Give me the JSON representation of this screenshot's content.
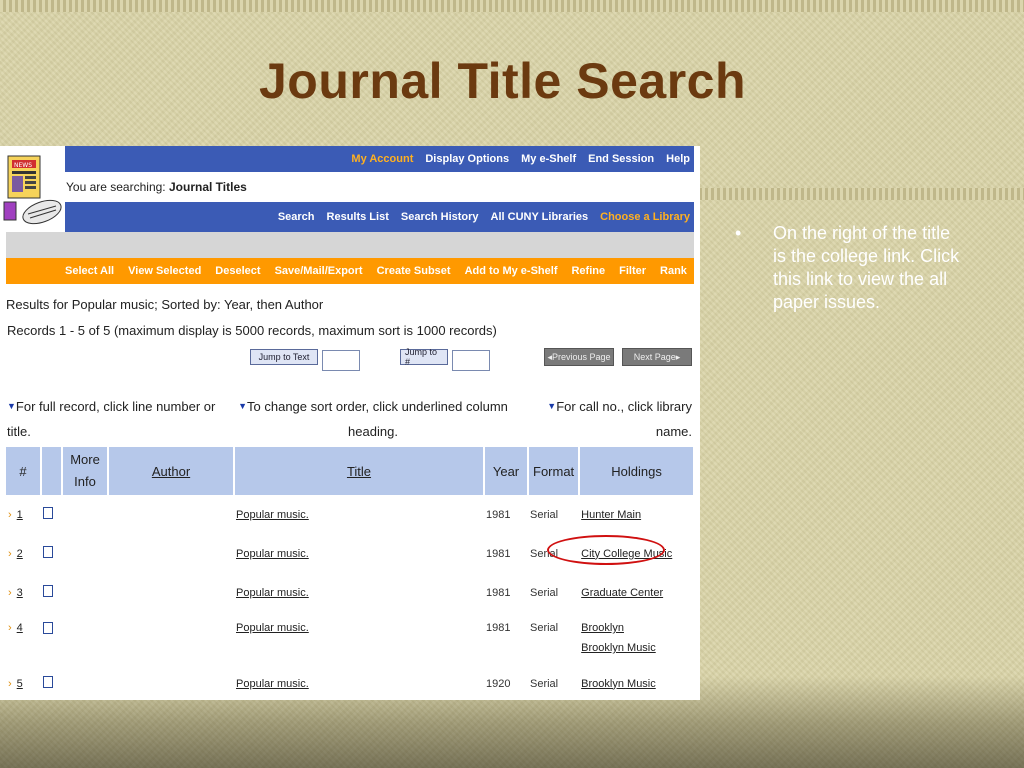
{
  "slide": {
    "title": "Journal Title Search",
    "bullet_char": "•",
    "bullet_text": "On the right of the title is the college link. Click this link to view the all paper issues."
  },
  "nav_top": {
    "items": [
      "My Account",
      "Display Options",
      "My e-Shelf",
      "End Session",
      "Help"
    ],
    "highlight": "My Account"
  },
  "searching": {
    "prefix": "You are searching:",
    "value": "Journal Titles"
  },
  "nav_second": {
    "items": [
      "Search",
      "Results List",
      "Search History",
      "All CUNY Libraries",
      "Choose a Library"
    ],
    "highlight": "Choose a Library"
  },
  "actions": [
    "Select All",
    "View Selected",
    "Deselect",
    "Save/Mail/Export",
    "Create Subset",
    "Add to My e-Shelf",
    "Refine",
    "Filter",
    "Rank"
  ],
  "results": {
    "summary": "Results for Popular music; Sorted by: Year, then Author",
    "records": "Records 1 - 5 of 5 (maximum display is 5000 records, maximum sort is 1000 records)"
  },
  "controls": {
    "jump_text": "Jump to Text",
    "jump_num": "Jump to #",
    "prev": "Previous Page",
    "next": "Next Page"
  },
  "hints": {
    "left_a": "For full record, click line number or",
    "left_b": "title.",
    "mid_a": "To change sort order, click underlined column",
    "mid_b": "heading.",
    "right_a": "For call no., click library",
    "right_b": "name."
  },
  "table": {
    "headers": {
      "num": "#",
      "more_a": "More",
      "more_b": "Info",
      "author": "Author",
      "title": "Title",
      "year": "Year",
      "format": "Format",
      "holdings": "Holdings"
    },
    "rows": [
      {
        "n": "1",
        "title": "Popular music.",
        "year": "1981",
        "format": "Serial",
        "holdings": [
          "Hunter Main"
        ]
      },
      {
        "n": "2",
        "title": "Popular music.",
        "year": "1981",
        "format": "Serial",
        "holdings": [
          "City College Music"
        ]
      },
      {
        "n": "3",
        "title": "Popular music.",
        "year": "1981",
        "format": "Serial",
        "holdings": [
          "Graduate Center"
        ]
      },
      {
        "n": "4",
        "title": "Popular music.",
        "year": "1981",
        "format": "Serial",
        "holdings": [
          "Brooklyn",
          "Brooklyn Music"
        ]
      },
      {
        "n": "5",
        "title": "Popular music.",
        "year": "1920",
        "format": "Serial",
        "holdings": [
          "Brooklyn Music"
        ]
      }
    ]
  },
  "colors": {
    "title": "#6b3a10",
    "nav_blue": "#3b5bb5",
    "action_orange": "#ff9900",
    "header_blue": "#b6c8ea",
    "annotation_red": "#d01010"
  },
  "icons": {
    "logo": "news-clipart-icon",
    "row_arrow": "chevron-right-icon",
    "checkbox": "checkbox-icon",
    "sort_hint": "triangle-down-icon"
  }
}
